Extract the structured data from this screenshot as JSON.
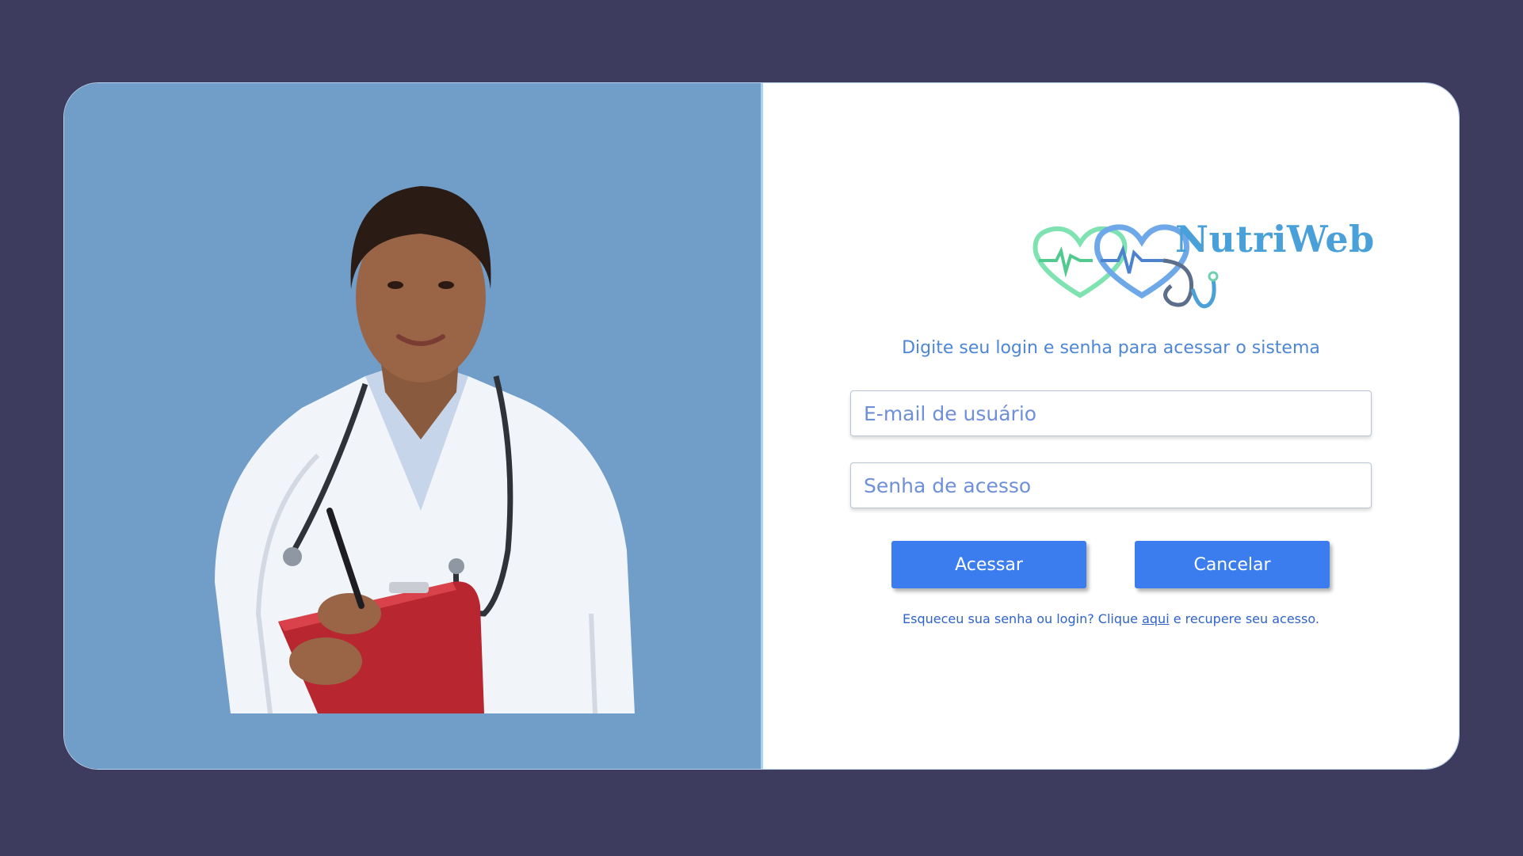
{
  "brand": {
    "name": "NutriWeb",
    "colors": {
      "background": "#3d3c5e",
      "image_panel": "#709ec9",
      "accent": "#3b7def",
      "logo_text": "#4aa0d8",
      "logo_heart_green": "#7ee3b0",
      "logo_heart_blue": "#6fa8e8"
    }
  },
  "login": {
    "subtitle": "Digite seu login e senha para acessar o sistema",
    "email_placeholder": "E-mail de usuário",
    "password_placeholder": "Senha de acesso",
    "access_label": "Acessar",
    "cancel_label": "Cancelar",
    "forgot_prefix": "Esqueceu sua senha ou login? Clique",
    "forgot_link": "aqui",
    "forgot_suffix": "e recupere seu acesso."
  },
  "icons": {
    "logo": "heart-stethoscope-logo-icon"
  }
}
